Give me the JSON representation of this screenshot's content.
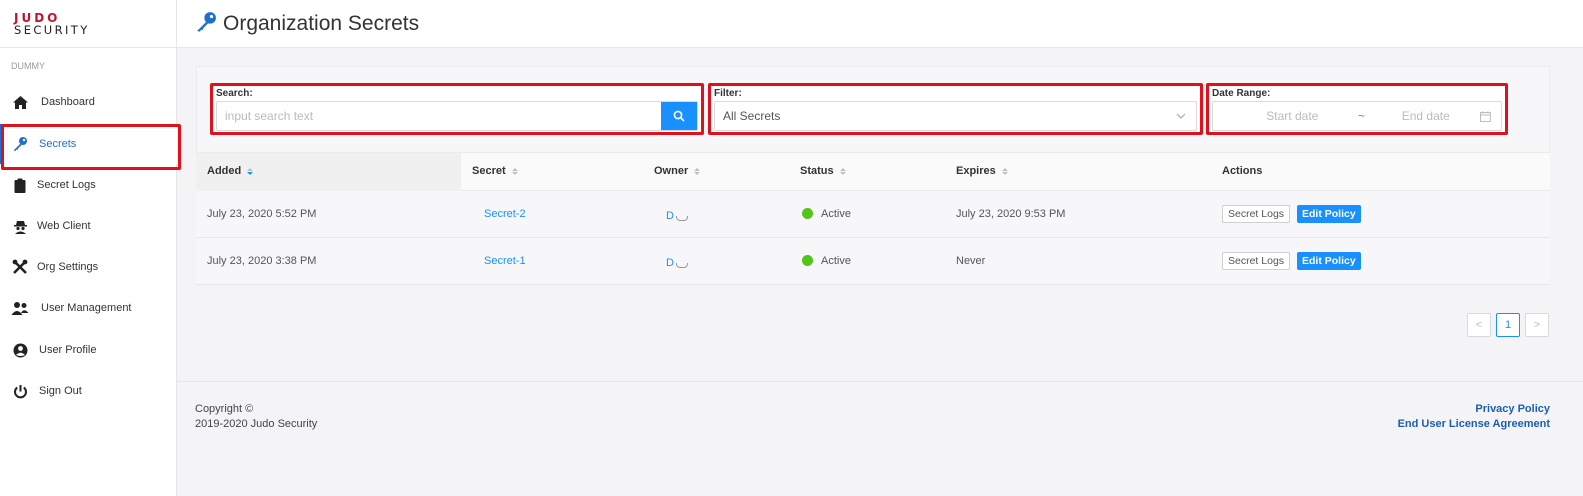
{
  "brand": {
    "line1": "JUDO",
    "line2": "SECURITY"
  },
  "org_name": "DUMMY",
  "nav": [
    {
      "label": "Dashboard",
      "icon": "home-icon"
    },
    {
      "label": "Secrets",
      "icon": "key-icon",
      "active": true
    },
    {
      "label": "Secret Logs",
      "icon": "clipboard-icon"
    },
    {
      "label": "Web Client",
      "icon": "spy-icon"
    },
    {
      "label": "Org Settings",
      "icon": "tools-icon"
    },
    {
      "label": "User Management",
      "icon": "users-icon"
    },
    {
      "label": "User Profile",
      "icon": "user-circle-icon"
    },
    {
      "label": "Sign Out",
      "icon": "power-icon"
    }
  ],
  "page": {
    "title": "Organization Secrets"
  },
  "filters": {
    "search_label": "Search:",
    "search_placeholder": "input search text",
    "filter_label": "Filter:",
    "filter_value": "All Secrets",
    "date_label": "Date Range:",
    "start_placeholder": "Start date",
    "range_sep": "~",
    "end_placeholder": "End date"
  },
  "table": {
    "columns": [
      "Added",
      "Secret",
      "Owner",
      "Status",
      "Expires",
      "Actions"
    ],
    "rows": [
      {
        "added": "July 23, 2020 5:52 PM",
        "secret": "Secret-2",
        "owner": "D",
        "status": "Active",
        "expires": "July 23, 2020 9:53 PM",
        "action1": "Secret Logs",
        "action2": "Edit Policy"
      },
      {
        "added": "July 23, 2020 3:38 PM",
        "secret": "Secret-1",
        "owner": "D",
        "status": "Active",
        "expires": "Never",
        "action1": "Secret Logs",
        "action2": "Edit Policy"
      }
    ]
  },
  "pagination": {
    "prev": "<",
    "current": "1",
    "next": ">"
  },
  "footer": {
    "copyright": "Copyright ©",
    "years": "2019-2020 Judo Security",
    "privacy": "Privacy Policy",
    "eula": "End User License Agreement"
  },
  "colors": {
    "accent": "#1890ff",
    "brand_red": "#c8102e",
    "highlight": "#e0101c",
    "active_status": "#52c41a"
  }
}
